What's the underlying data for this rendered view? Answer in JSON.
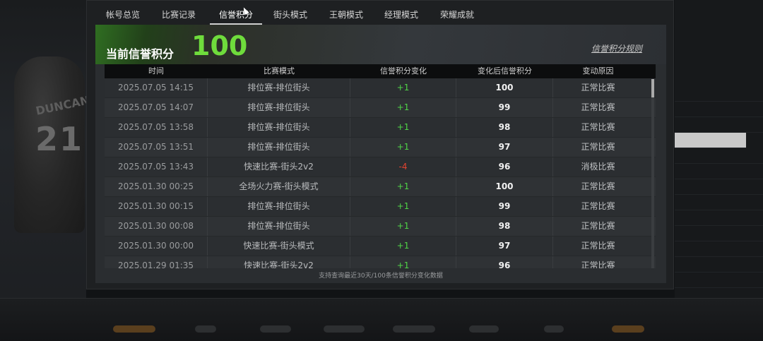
{
  "tabs": [
    {
      "label": "帐号总览"
    },
    {
      "label": "比赛记录"
    },
    {
      "label": "信誉积分"
    },
    {
      "label": "街头模式"
    },
    {
      "label": "王朝模式"
    },
    {
      "label": "经理模式"
    },
    {
      "label": "荣耀成就"
    }
  ],
  "active_tab": "信誉积分",
  "credit": {
    "label": "当前信誉积分",
    "value": "100",
    "rules_link": "信誉积分规则"
  },
  "table": {
    "headers": [
      "时间",
      "比赛模式",
      "信誉积分变化",
      "变化后信誉积分",
      "变动原因"
    ],
    "rows": [
      {
        "time": "2025.07.05  14:15",
        "mode": "排位赛-排位街头",
        "change": "+1",
        "after": "100",
        "reason": "正常比赛"
      },
      {
        "time": "2025.07.05  14:07",
        "mode": "排位赛-排位街头",
        "change": "+1",
        "after": "99",
        "reason": "正常比赛"
      },
      {
        "time": "2025.07.05  13:58",
        "mode": "排位赛-排位街头",
        "change": "+1",
        "after": "98",
        "reason": "正常比赛"
      },
      {
        "time": "2025.07.05  13:51",
        "mode": "排位赛-排位街头",
        "change": "+1",
        "after": "97",
        "reason": "正常比赛"
      },
      {
        "time": "2025.07.05  13:43",
        "mode": "快速比赛-街头2v2",
        "change": "-4",
        "after": "96",
        "reason": "消极比赛"
      },
      {
        "time": "2025.01.30  00:25",
        "mode": "全场火力赛-街头模式",
        "change": "+1",
        "after": "100",
        "reason": "正常比赛"
      },
      {
        "time": "2025.01.30  00:15",
        "mode": "排位赛-排位街头",
        "change": "+1",
        "after": "99",
        "reason": "正常比赛"
      },
      {
        "time": "2025.01.30  00:08",
        "mode": "排位赛-排位街头",
        "change": "+1",
        "after": "98",
        "reason": "正常比赛"
      },
      {
        "time": "2025.01.30  00:00",
        "mode": "快速比赛-街头模式",
        "change": "+1",
        "after": "97",
        "reason": "正常比赛"
      },
      {
        "time": "2025.01.29  01:35",
        "mode": "快速比赛-街头2v2",
        "change": "+1",
        "after": "96",
        "reason": "正常比赛"
      }
    ]
  },
  "footer_note": "支持查询最近30天/100条信誉积分变化数据",
  "background": {
    "jersey_name": "DUNCAN",
    "jersey_number": "21"
  },
  "colors": {
    "positive": "#4fd447",
    "negative": "#e3432f",
    "credit_value": "#6fdc3c"
  }
}
